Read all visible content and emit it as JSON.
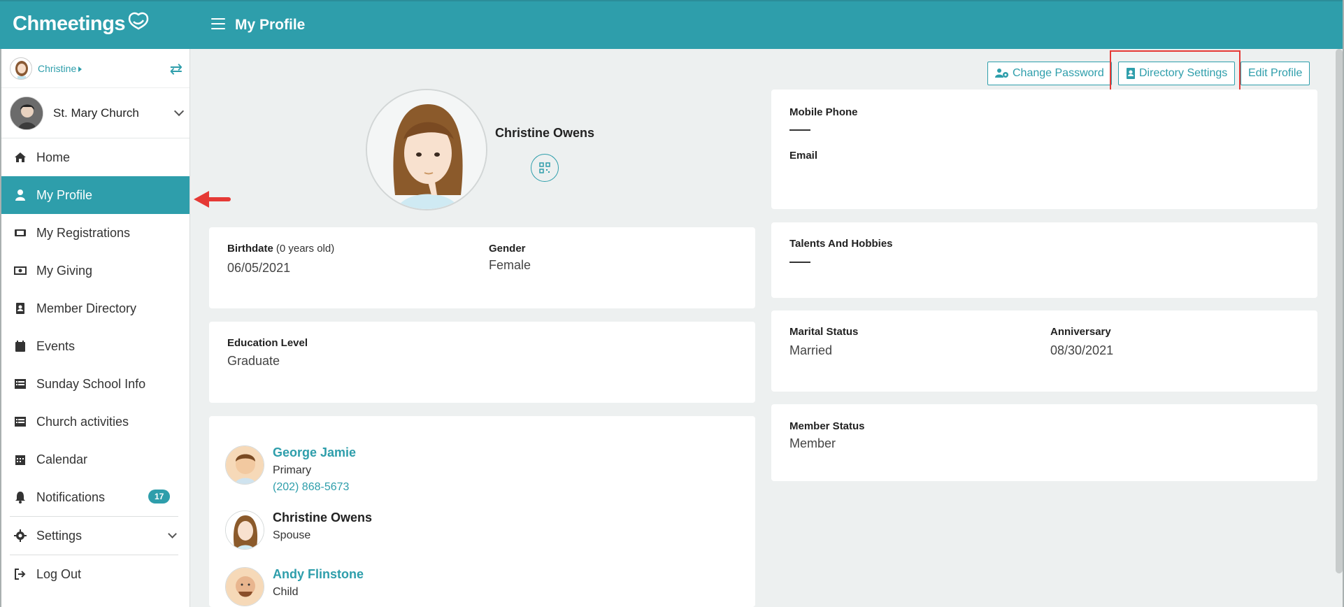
{
  "app": {
    "logo_text": "Chmeetings",
    "page_title": "My Profile"
  },
  "user": {
    "name": "Christine"
  },
  "church": {
    "name": "St. Mary Church"
  },
  "nav": {
    "items": [
      {
        "label": "Home",
        "icon": "home-icon"
      },
      {
        "label": "My Profile",
        "icon": "user-icon",
        "active": true
      },
      {
        "label": "My Registrations",
        "icon": "ticket-icon"
      },
      {
        "label": "My Giving",
        "icon": "money-icon"
      },
      {
        "label": "Member Directory",
        "icon": "address-book-icon"
      },
      {
        "label": "Events",
        "icon": "calendar-icon"
      },
      {
        "label": "Sunday School Info",
        "icon": "list-icon"
      },
      {
        "label": "Church activities",
        "icon": "list-icon"
      },
      {
        "label": "Calendar",
        "icon": "calendar-grid-icon"
      },
      {
        "label": "Notifications",
        "icon": "bell-icon",
        "badge": "17"
      }
    ],
    "settings_label": "Settings",
    "logout_label": "Log Out"
  },
  "actions": {
    "change_password": "Change Password",
    "directory_settings": "Directory Settings",
    "edit_profile": "Edit Profile"
  },
  "profile": {
    "name": "Christine Owens",
    "birthdate_label": "Birthdate",
    "birthdate_age": "(0 years old)",
    "birthdate": "06/05/2021",
    "gender_label": "Gender",
    "gender": "Female",
    "education_label": "Education Level",
    "education": "Graduate",
    "mobile_label": "Mobile Phone",
    "email_label": "Email",
    "talents_label": "Talents And Hobbies",
    "marital_label": "Marital Status",
    "marital": "Married",
    "anniversary_label": "Anniversary",
    "anniversary": "08/30/2021",
    "member_status_label": "Member Status",
    "member_status": "Member"
  },
  "family": [
    {
      "name": "George Jamie",
      "role": "Primary",
      "phone": "(202) 868-5673"
    },
    {
      "name": "Christine Owens",
      "role": "Spouse"
    },
    {
      "name": "Andy Flinstone",
      "role": "Child"
    }
  ],
  "colors": {
    "brand": "#2e9eab",
    "annotation": "#e53935"
  }
}
